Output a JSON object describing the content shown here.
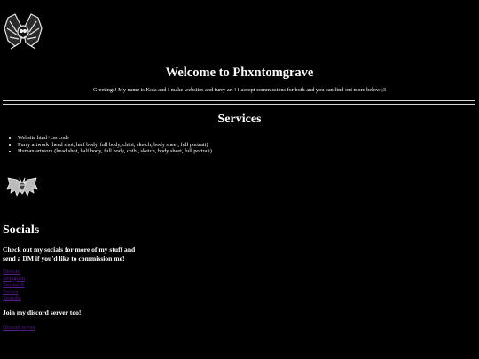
{
  "header": {
    "logo_icon": "winged-skull-icon",
    "title": "Welcome to Phxntomgrave",
    "intro": "Greetings! My name is Kota and I make websites and furry art ! I accept commissions for both and you can find out more below ;3"
  },
  "services": {
    "title": "Services",
    "items": [
      "Website html+css code",
      "Furry artwork (head shot, half body, full body, chibi, sketch, body sheet, full portrait)",
      "Human artwork (head shot, half body, full body, chibi, sketch, body sheet, full portrait)"
    ],
    "divider_icon": "bat-icon"
  },
  "socials": {
    "title": "Socials",
    "text": "Check out my socials for more of my stuff and send a DM if you'd like to commission me!",
    "links": [
      "Discord",
      "Instagram",
      "Twitter/X",
      "Twitch",
      "Youtube"
    ],
    "discord_text": "Join my discord server too!",
    "server_link": "Discord server"
  },
  "colors": {
    "background": "#000000",
    "text": "#ffffff",
    "link": "#551a8b"
  }
}
